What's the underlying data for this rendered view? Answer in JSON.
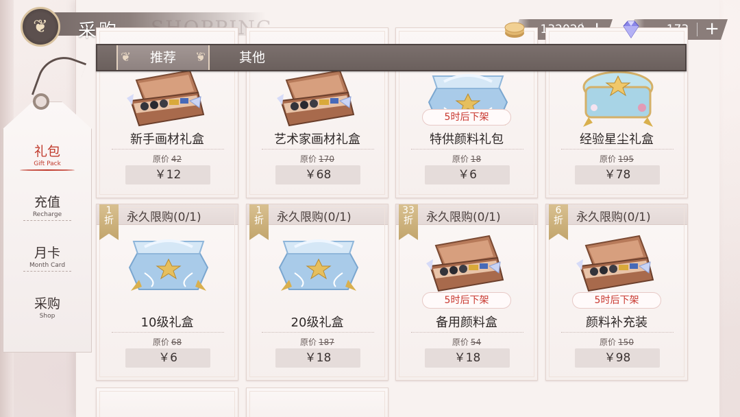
{
  "header": {
    "title": "采购",
    "subtitle": "SHOPPING LIST"
  },
  "currency": {
    "coins": {
      "icon": "coin-stack-icon",
      "amount": "132029",
      "plus": "+"
    },
    "gems": {
      "icon": "diamond-icon",
      "amount": "173",
      "plus": "+"
    }
  },
  "tabs": [
    {
      "label": "推荐",
      "active": true
    },
    {
      "label": "其他",
      "active": false
    }
  ],
  "sidebar": {
    "items": [
      {
        "zh": "礼包",
        "en": "Gift Pack",
        "active": true
      },
      {
        "zh": "充值",
        "en": "Recharge",
        "active": false
      },
      {
        "zh": "月卡",
        "en": "Month Card",
        "active": false
      },
      {
        "zh": "采购",
        "en": "Shop",
        "active": false
      }
    ]
  },
  "orig_label": "原价",
  "cards_row1": [
    {
      "name": "新手画材礼盒",
      "orig": "42",
      "price": "￥12",
      "art": "paint-box-icon"
    },
    {
      "name": "艺术家画材礼盒",
      "orig": "170",
      "price": "￥68",
      "art": "paint-box-icon"
    },
    {
      "name": "特供颜料礼包",
      "orig": "18",
      "price": "￥6",
      "timer": "5时后下架",
      "art": "blue-gift-box-icon"
    },
    {
      "name": "经验星尘礼盒",
      "orig": "195",
      "price": "￥78",
      "art": "crystal-chest-icon"
    }
  ],
  "cards_row2": [
    {
      "discount": [
        "1",
        "折"
      ],
      "limit": "永久限购(0/1)",
      "name": "10级礼盒",
      "orig": "68",
      "price": "￥6",
      "art": "blue-gift-box-icon"
    },
    {
      "discount": [
        "1",
        "折"
      ],
      "limit": "永久限购(0/1)",
      "name": "20级礼盒",
      "orig": "187",
      "price": "￥18",
      "art": "blue-gift-box-icon"
    },
    {
      "discount": [
        "33",
        "折"
      ],
      "limit": "永久限购(0/1)",
      "name": "备用颜料盒",
      "orig": "54",
      "price": "￥18",
      "timer": "5时后下架",
      "art": "paint-box-icon"
    },
    {
      "discount": [
        "6",
        "折"
      ],
      "limit": "永久限购(0/1)",
      "name": "颜料补充装",
      "orig": "150",
      "price": "￥98",
      "timer": "5时后下架",
      "art": "paint-box-icon"
    }
  ]
}
